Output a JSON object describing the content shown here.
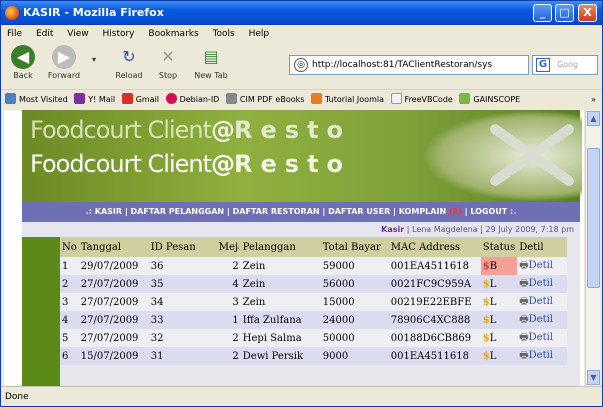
{
  "window": {
    "title": "KASIR - Mozilla Firefox",
    "min": "_",
    "max": "□",
    "close": "X"
  },
  "menu": [
    "File",
    "Edit",
    "View",
    "History",
    "Bookmarks",
    "Tools",
    "Help"
  ],
  "nav": {
    "back": "Back",
    "forward": "Forward",
    "reload": "Reload",
    "stop": "Stop",
    "newtab": "New Tab",
    "url": "http://localhost:81/TAClientRestoran/sys",
    "search": "Goog"
  },
  "bookmarks": [
    "Most Visited",
    "Y! Mail",
    "Gmail",
    "Debian-ID",
    "CIM PDF eBooks",
    "Tutorial Joomla",
    "FreeVBCode",
    "GAINSCOPE"
  ],
  "banner": {
    "brand": "Foodcourt Client",
    "at": "@",
    "resto": "Resto"
  },
  "navstrip": {
    "prefix": ".: KASIR | DAFTAR PELANGGAN | DAFTAR RESTORAN | DAFTAR USER | KOMPLAIN ",
    "count": "(2)",
    "suffix": " | LOGOUT :."
  },
  "userline": {
    "role": "Kasir",
    "rest": " | Lena Magdelena | 29 July 2009, 7:18 pm"
  },
  "table": {
    "headers": [
      "No",
      "Tanggal",
      "ID Pesan",
      "Meja",
      "Pelanggan",
      "Total Bayar",
      "MAC Address",
      "Status",
      "Detil"
    ],
    "rows": [
      [
        "1",
        "29/07/2009",
        "36",
        "2",
        "Zein",
        "59000",
        "001EA4511618",
        "B",
        "Detil"
      ],
      [
        "2",
        "27/07/2009",
        "35",
        "4",
        "Zein",
        "56000",
        "0021FC9C959A",
        "L",
        "Detil"
      ],
      [
        "3",
        "27/07/2009",
        "34",
        "3",
        "Zein",
        "15000",
        "00219E22EBFE",
        "L",
        "Detil"
      ],
      [
        "4",
        "27/07/2009",
        "33",
        "1",
        "Iffa Zulfana",
        "24000",
        "78906C4XC888",
        "L",
        "Detil"
      ],
      [
        "5",
        "27/07/2009",
        "32",
        "2",
        "Hepi Salma",
        "50000",
        "00188D6CB869",
        "L",
        "Detil"
      ],
      [
        "6",
        "15/07/2009",
        "31",
        "2",
        "Dewi Persik",
        "9000",
        "001EA4511618",
        "L",
        "Detil"
      ]
    ]
  },
  "status": "Done",
  "colors": {
    "titlebar": "#0857de",
    "navstrip": "#6f6fb6",
    "page": "#5b8a18"
  }
}
